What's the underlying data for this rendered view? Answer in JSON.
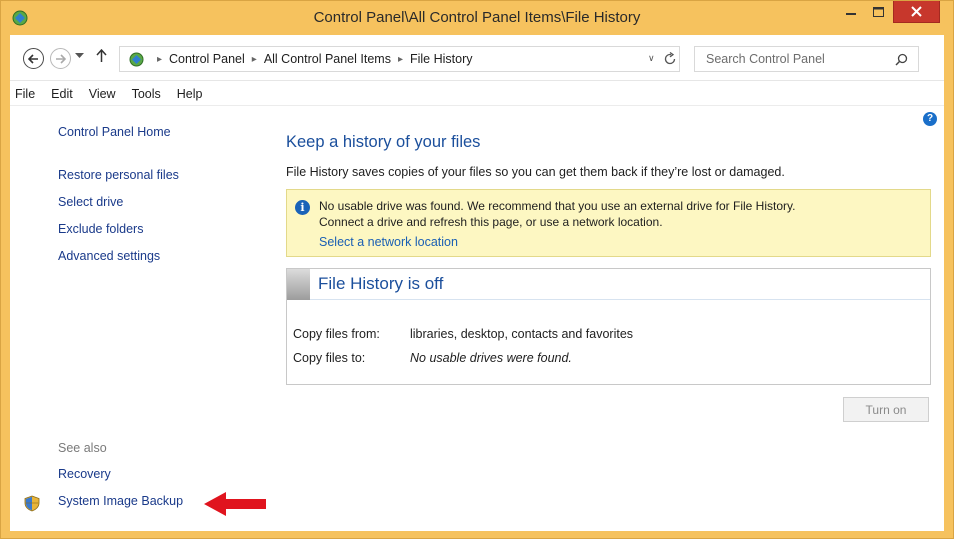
{
  "window": {
    "title": "Control Panel\\All Control Panel Items\\File History",
    "controls": {
      "minimize": "–",
      "maximize": "□",
      "close": "✕"
    },
    "frame_color": "#f6c25e",
    "close_color": "#c7372c"
  },
  "navigation": {
    "back_icon": "back-arrow-icon",
    "forward_icon": "forward-arrow-icon",
    "recent_icon": "chevron-down-icon",
    "up_icon": "up-arrow-icon"
  },
  "address": {
    "breadcrumbs": [
      "Control Panel",
      "All Control Panel Items",
      "File History"
    ],
    "separator": "▸",
    "dropdown": "∨",
    "refresh_icon": "refresh-icon"
  },
  "search": {
    "placeholder": "Search Control Panel",
    "icon": "search-icon"
  },
  "menu": {
    "file": "File",
    "edit": "Edit",
    "view": "View",
    "tools": "Tools",
    "help": "Help"
  },
  "sidebar": {
    "home": "Control Panel Home",
    "items": [
      "Restore personal files",
      "Select drive",
      "Exclude folders",
      "Advanced settings"
    ],
    "see_also": "See also",
    "recovery": "Recovery",
    "system_image": "System Image Backup"
  },
  "help_icon": "?",
  "main": {
    "title": "Keep a history of your files",
    "description": "File History saves copies of your files so you can get them back if they’re lost or damaged.",
    "info": {
      "icon": "i",
      "line1": "No usable drive was found. We recommend that you use an external drive for File History.",
      "line2": "Connect a drive and refresh this page, or use a network location.",
      "link": "Select a network location"
    },
    "status": {
      "title": "File History is off",
      "copy_from_label": "Copy files from:",
      "copy_from_value": "libraries, desktop, contacts and favorites",
      "copy_to_label": "Copy files to:",
      "copy_to_value": "No usable drives were found."
    },
    "turn_on": "Turn on"
  },
  "annotation": {
    "arrow_color": "#e0141e"
  }
}
